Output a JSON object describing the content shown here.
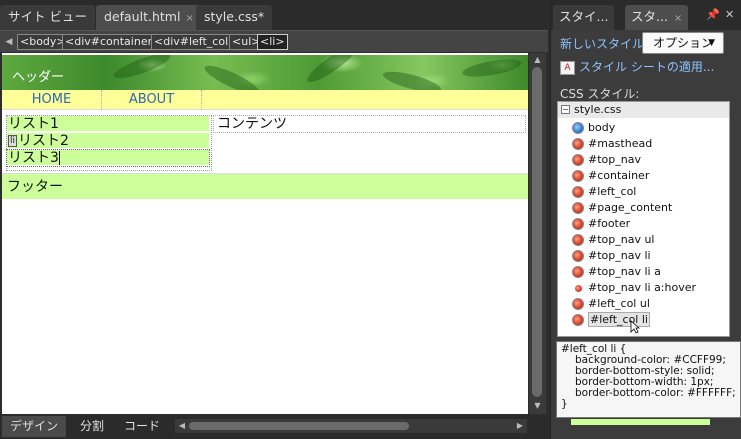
{
  "editor": {
    "tabs": [
      {
        "label": "サイト ビュー",
        "active": false
      },
      {
        "label": "default.html",
        "active": true,
        "close": "×"
      },
      {
        "label": "style.css*",
        "active": false
      }
    ],
    "breadcrumb": {
      "prev_arrow": "◀",
      "items": [
        "<body>",
        "<div#container>",
        "<div#left_col>",
        "<ul>",
        "<li>"
      ],
      "selected_index": 4
    },
    "page": {
      "masthead_text": "ヘッダー",
      "top_nav": [
        "HOME",
        "ABOUT"
      ],
      "list_items": [
        "リスト1",
        "リスト2",
        "リスト3"
      ],
      "li_tag": "li",
      "content_text": "コンテンツ",
      "footer_text": "フッター"
    },
    "view_tabs": [
      {
        "label": "デザイン",
        "active": true
      },
      {
        "label": "分割",
        "active": false
      },
      {
        "label": "コード",
        "active": false
      }
    ],
    "scroll_left": "◀",
    "scroll_right": "▶",
    "scroll_up": "▲",
    "scroll_down": "▼"
  },
  "panel": {
    "tabs": [
      {
        "label": "スタイ...",
        "active": false
      },
      {
        "label": "スタ...",
        "active": true,
        "close": "×"
      }
    ],
    "pin": "📌",
    "close": "✕",
    "new_style": "新しいスタイル...",
    "options_button": "オプション",
    "options_arrow": "▼",
    "apply_icon_text": "A",
    "apply_style_sheet": "スタイル シートの適用...",
    "css_styles_label": "CSS スタイル:",
    "tree": {
      "toggle": "−",
      "root": "style.css",
      "rules": [
        {
          "name": "body",
          "kind": "blue"
        },
        {
          "name": "#masthead",
          "kind": "red"
        },
        {
          "name": "#top_nav",
          "kind": "red"
        },
        {
          "name": "#container",
          "kind": "red"
        },
        {
          "name": "#left_col",
          "kind": "red"
        },
        {
          "name": "#page_content",
          "kind": "red"
        },
        {
          "name": "#footer",
          "kind": "red"
        },
        {
          "name": "#top_nav ul",
          "kind": "red"
        },
        {
          "name": "#top_nav li",
          "kind": "red"
        },
        {
          "name": "#top_nav li a",
          "kind": "red"
        },
        {
          "name": "#top_nav li a:hover",
          "kind": "small"
        },
        {
          "name": "#left_col ul",
          "kind": "red"
        },
        {
          "name": "#left_col li",
          "kind": "red",
          "highlight": true
        }
      ]
    },
    "tooltip": {
      "selector": "#left_col li {",
      "lines": [
        "background-color: #CCFF99;",
        "border-bottom-style: solid;",
        "border-bottom-width: 1px;",
        "border-bottom-color: #FFFFFF;"
      ],
      "end": "}"
    }
  },
  "colors": {
    "list_bg": "#CCFF99",
    "nav_bg": "#FFFF99",
    "link": "#8CC3FF"
  }
}
